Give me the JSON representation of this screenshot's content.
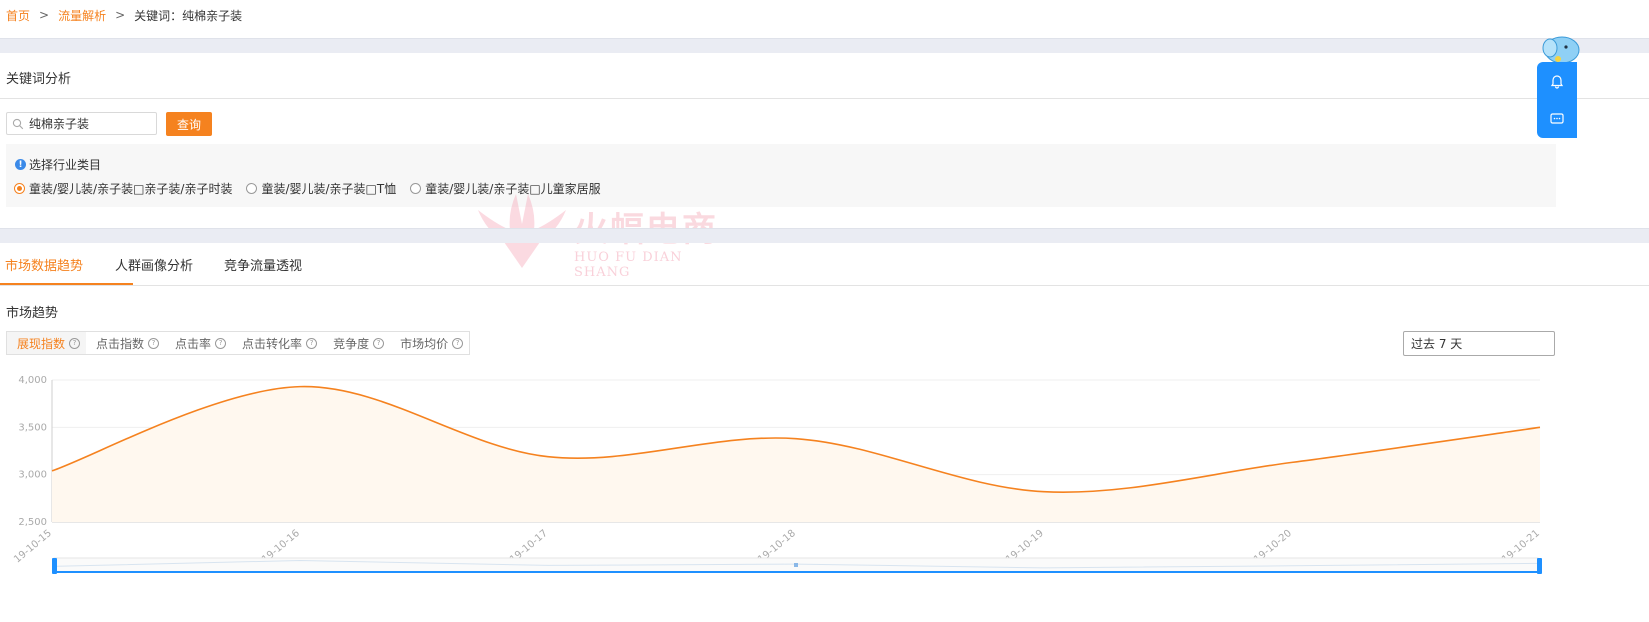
{
  "breadcrumb": {
    "home": "首页",
    "traffic": "流量解析",
    "current": "关键词：纯棉亲子装",
    "sep": ">"
  },
  "keyword_panel": {
    "title": "关键词分析",
    "search_value": "纯棉亲子装",
    "query_label": "查询",
    "industry_label": "选择行业类目",
    "options": [
      "童装/婴儿装/亲子装□亲子装/亲子时装",
      "童装/婴儿装/亲子装□T恤",
      "童装/婴儿装/亲子装□儿童家居服"
    ],
    "selected_option": 0
  },
  "watermark": {
    "cn": "火蝠电商",
    "en": "HUO FU DIAN SHANG"
  },
  "tabs": [
    "市场数据趋势",
    "人群画像分析",
    "竞争流量透视"
  ],
  "active_tab": 0,
  "trend": {
    "title": "市场趋势",
    "metrics": [
      "展现指数",
      "点击指数",
      "点击率",
      "点击转化率",
      "竞争度",
      "市场均价"
    ],
    "active_metric": 0,
    "range": "过去 7 天"
  },
  "colors": {
    "accent": "#f5821f",
    "side_widget": "#1e90ff",
    "area_fill": "#fff8ef"
  },
  "chart_data": {
    "type": "line",
    "x": [
      "19-10-15",
      "19-10-16",
      "19-10-17",
      "19-10-18",
      "19-10-19",
      "19-10-20",
      "19-10-21"
    ],
    "y_ticks": [
      "2,500",
      "3,000",
      "3,500",
      "4,000"
    ],
    "ylim": [
      2500,
      4000
    ],
    "series": [
      {
        "values": [
          3040,
          3930,
          3190,
          3380,
          2820,
          3130,
          3500
        ]
      }
    ],
    "area": true,
    "grid": true
  },
  "side_icons": [
    "bell-icon",
    "chat-icon"
  ]
}
